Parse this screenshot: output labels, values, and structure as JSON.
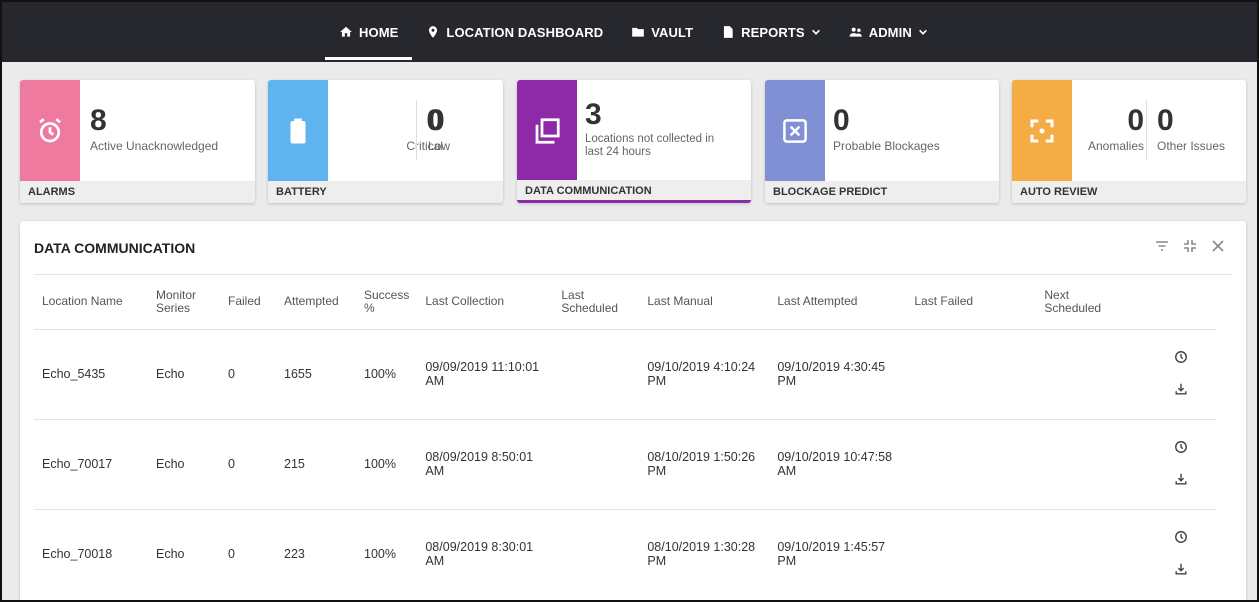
{
  "nav": {
    "items": [
      {
        "label": "HOME",
        "icon": "home-icon"
      },
      {
        "label": "LOCATION DASHBOARD",
        "icon": "location-pin-icon"
      },
      {
        "label": "VAULT",
        "icon": "folder-icon"
      },
      {
        "label": "REPORTS",
        "icon": "document-icon"
      },
      {
        "label": "ADMIN",
        "icon": "users-icon"
      }
    ]
  },
  "cards": {
    "alarms": {
      "title": "ALARMS",
      "color": "#ee7aa0",
      "metric1": {
        "value": "8",
        "label": "Active Unacknowledged"
      }
    },
    "battery": {
      "title": "BATTERY",
      "color": "#5fb3ee",
      "metric1": {
        "value": "0",
        "label": "Critical"
      },
      "metric2": {
        "value": "0",
        "label": "Low"
      }
    },
    "datacomm": {
      "title": "DATA COMMUNICATION",
      "color": "#8e2aa8",
      "metric1": {
        "value": "3",
        "label": "Locations not collected in last 24 hours"
      }
    },
    "blockage": {
      "title": "BLOCKAGE PREDICT",
      "color": "#8190d4",
      "metric1": {
        "value": "0",
        "label": "Probable Blockages"
      }
    },
    "autoreview": {
      "title": "AUTO REVIEW",
      "color": "#f4ad45",
      "metric1": {
        "value": "0",
        "label": "Anomalies"
      },
      "metric2": {
        "value": "0",
        "label": "Other Issues"
      }
    }
  },
  "panel": {
    "title": "DATA COMMUNICATION",
    "columns": [
      "Location Name",
      "Monitor Series",
      "Failed",
      "Attempted",
      "Success %",
      "Last Collection",
      "Last Scheduled",
      "Last Manual",
      "Last Attempted",
      "Last Failed",
      "Next Scheduled"
    ],
    "rows": [
      {
        "location": "Echo_5435",
        "series": "Echo",
        "failed": "0",
        "attempted": "1655",
        "success": "100%",
        "last_collection": "09/09/2019 11:10:01 AM",
        "last_scheduled": "",
        "last_manual": "09/10/2019 4:10:24 PM",
        "last_attempted": "09/10/2019 4:30:45 PM",
        "last_failed": "",
        "next_scheduled": ""
      },
      {
        "location": "Echo_70017",
        "series": "Echo",
        "failed": "0",
        "attempted": "215",
        "success": "100%",
        "last_collection": "08/09/2019 8:50:01 AM",
        "last_scheduled": "",
        "last_manual": "08/10/2019 1:50:26 PM",
        "last_attempted": "09/10/2019 10:47:58 AM",
        "last_failed": "",
        "next_scheduled": ""
      },
      {
        "location": "Echo_70018",
        "series": "Echo",
        "failed": "0",
        "attempted": "223",
        "success": "100%",
        "last_collection": "08/09/2019 8:30:01 AM",
        "last_scheduled": "",
        "last_manual": "08/10/2019 1:30:28 PM",
        "last_attempted": "09/10/2019 1:45:57 PM",
        "last_failed": "",
        "next_scheduled": ""
      }
    ]
  }
}
